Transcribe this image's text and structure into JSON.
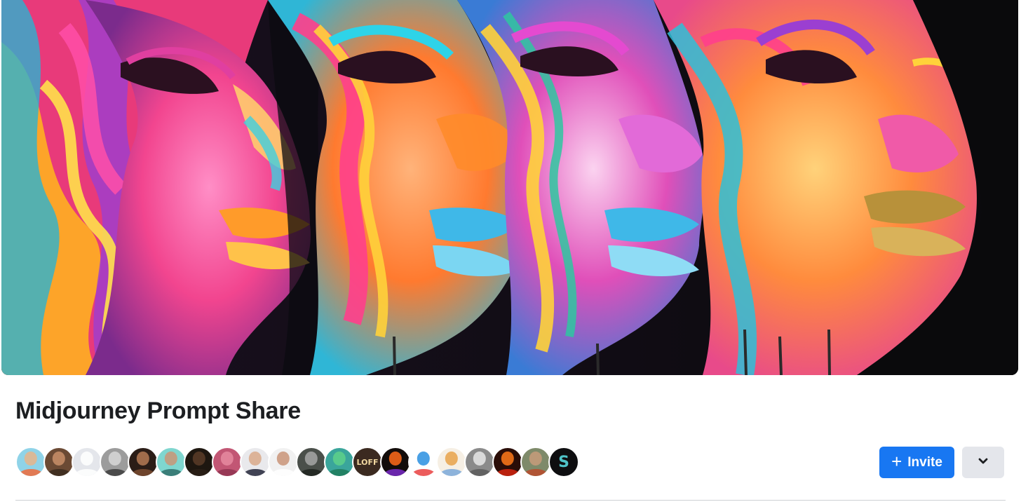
{
  "group": {
    "name": "Midjourney Prompt Share",
    "cover_image": "colorful-painted-faces-cover-photo"
  },
  "members": [
    {
      "icon": "member-avatar",
      "bg": "#8fd3e8",
      "face": "#e8b48a",
      "body": "#f06a3a"
    },
    {
      "icon": "member-avatar",
      "bg": "#6b4a34",
      "face": "#c98f6a",
      "body": "#3a2a1f"
    },
    {
      "icon": "default-avatar",
      "bg": "#e4e6eb",
      "face": "#ffffff",
      "body": "#ffffff"
    },
    {
      "icon": "member-avatar",
      "bg": "#9c9c9c",
      "face": "#d8d8d8",
      "body": "#3d3d3d"
    },
    {
      "icon": "member-avatar",
      "bg": "#2b1d17",
      "face": "#b57a55",
      "body": "#7a4b30"
    },
    {
      "icon": "member-avatar",
      "bg": "#7fd6cf",
      "face": "#c99577",
      "body": "#2f6f6a"
    },
    {
      "icon": "member-avatar",
      "bg": "#1e1710",
      "face": "#5a3c28",
      "body": "#2a1f16"
    },
    {
      "icon": "member-avatar",
      "bg": "#c25674",
      "face": "#e68aa0",
      "body": "#8f3350"
    },
    {
      "icon": "member-avatar",
      "bg": "#e9e9ec",
      "face": "#d9a98a",
      "body": "#23263a"
    },
    {
      "icon": "member-avatar",
      "bg": "#f1f1f1",
      "face": "#c99478",
      "body": "#ffffff"
    },
    {
      "icon": "member-avatar",
      "bg": "#4a4f4a",
      "face": "#a6a6a6",
      "body": "#1f231f"
    },
    {
      "icon": "member-avatar",
      "bg": "#3aa59b",
      "face": "#5ed08a",
      "body": "#1f7a5a"
    },
    {
      "icon": "logo-avatar",
      "bg": "#3b2a20",
      "glyph": "LOFF",
      "glyph_color": "#f2d8a0"
    },
    {
      "icon": "member-avatar",
      "bg": "#120c0a",
      "face": "#ff6b1a",
      "body": "#7a2cc9"
    },
    {
      "icon": "member-avatar",
      "bg": "#ffffff",
      "face": "#2a8fe0",
      "body": "#e94040"
    },
    {
      "icon": "member-avatar",
      "bg": "#f6efe4",
      "face": "#e7a24a",
      "body": "#7aa8d9"
    },
    {
      "icon": "member-avatar",
      "bg": "#8a8a8a",
      "face": "#e6e6e6",
      "body": "#5a5a5a"
    },
    {
      "icon": "member-avatar",
      "bg": "#2a0d08",
      "face": "#ff7a1a",
      "body": "#d4260f"
    },
    {
      "icon": "member-avatar",
      "bg": "#7e8a6a",
      "face": "#c79b7a",
      "body": "#b84a2a"
    },
    {
      "icon": "logo-avatar",
      "bg": "#0e0e10",
      "glyph": "S",
      "glyph_color": "#4fc3c8"
    }
  ],
  "actions": {
    "invite_label": "Invite",
    "invite_icon": "plus-icon",
    "more_icon": "chevron-down-icon"
  },
  "colors": {
    "primary": "#1877f2",
    "secondary_button": "#e4e6eb",
    "title_text": "#1c1e21"
  }
}
